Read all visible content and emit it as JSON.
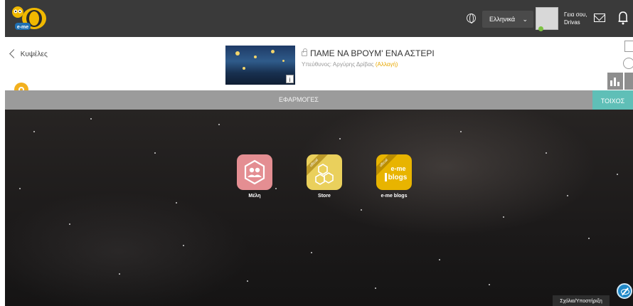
{
  "topbar": {
    "logo_text": "e-me",
    "language": "Ελληνικά",
    "greeting": "Γεια σου,",
    "username": "Drivas"
  },
  "header": {
    "back_label": "Κυψέλες",
    "room_title": "ΠΑΜΕ ΝΑ ΒΡΟΥΜ' ΕΝΑ ΑΣΤΕΡΙ",
    "owner_label": "Υπεύθυνος: Αργύρης Δρίβας",
    "change_label": "(Αλλαγή)",
    "info_glyph": "i"
  },
  "section": {
    "apps_label": "ΕΦΑΡΜΟΓΕΣ",
    "wall_tab": "ΤΟΙΧΟΣ"
  },
  "apps": [
    {
      "label": "Μέλη",
      "icon": "members-icon",
      "color": "#e48e92"
    },
    {
      "label": "Store",
      "icon": "hexagons-icon",
      "color": "#ead05c",
      "ribbon": "official"
    },
    {
      "label": "e-me blogs",
      "icon": "blogs-icon",
      "color": "#e8b400",
      "ribbon": "official",
      "tile_text_1": "e-me",
      "tile_text_2": "blogs"
    }
  ],
  "footer": {
    "support_label": "Σχόλια/Υποστήριξη"
  },
  "colors": {
    "topbar": "#3a3a3a",
    "accent_yellow": "#e8a800",
    "wall_teal": "#5fbfb7",
    "section_gray": "#9b9b9b"
  }
}
